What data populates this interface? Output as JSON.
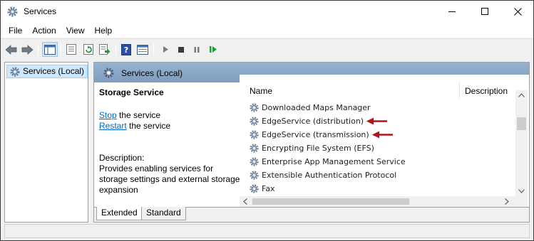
{
  "window": {
    "title": "Services",
    "icon": "gear-icon",
    "controls": [
      "minimize-icon",
      "maximize-icon",
      "close-icon"
    ]
  },
  "menu": [
    {
      "label": "File"
    },
    {
      "label": "Action"
    },
    {
      "label": "View"
    },
    {
      "label": "Help"
    }
  ],
  "toolbar": {
    "buttons": [
      "back-arrow-icon",
      "forward-arrow-icon",
      "show-hide-tree-icon",
      "properties-icon",
      "refresh-icon",
      "export-list-icon",
      "help-icon",
      "console-view-icon",
      "start-service-icon",
      "stop-service-icon",
      "pause-service-icon",
      "restart-service-icon"
    ]
  },
  "tree": {
    "selected_label": "Services (Local)"
  },
  "pane": {
    "header_title": "Services (Local)"
  },
  "details": {
    "service_title": "Storage Service",
    "stop_link": "Stop",
    "stop_suffix": " the service",
    "restart_link": "Restart",
    "restart_suffix": " the service",
    "description_label": "Description:",
    "description_text": "Provides enabling services for storage settings and external storage expansion"
  },
  "list": {
    "columns": {
      "name": "Name",
      "description": "Description"
    },
    "rows": [
      {
        "name": "Downloaded Maps Manager",
        "arrow": false
      },
      {
        "name": "EdgeService (distribution)",
        "arrow": true
      },
      {
        "name": "EdgeService (transmission)",
        "arrow": true
      },
      {
        "name": "Encrypting File System (EFS)",
        "arrow": false
      },
      {
        "name": "Enterprise App Management Service",
        "arrow": false
      },
      {
        "name": "Extensible Authentication Protocol",
        "arrow": false
      },
      {
        "name": "Fax",
        "arrow": false
      }
    ],
    "annotation_color": "#b5121b"
  },
  "tabs": [
    {
      "label": "Extended",
      "selected": true
    },
    {
      "label": "Standard",
      "selected": false
    }
  ],
  "colors": {
    "pane_header": "#8aa8c8",
    "selection": "#cce8ff",
    "link": "#0066cc"
  }
}
